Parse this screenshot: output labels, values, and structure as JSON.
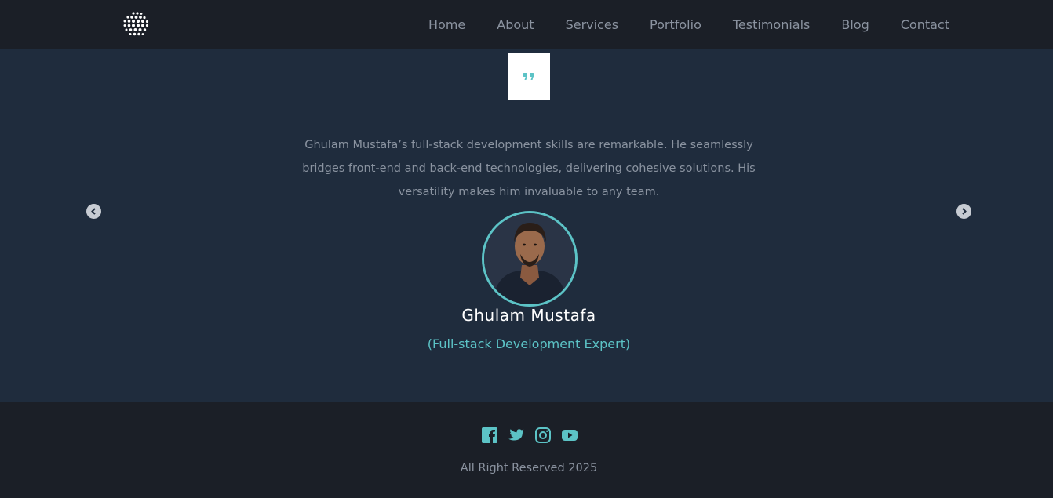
{
  "nav": {
    "logo_icon": "dot-sphere-logo-icon",
    "links": [
      {
        "label": "Home"
      },
      {
        "label": "About"
      },
      {
        "label": "Services"
      },
      {
        "label": "Portfolio"
      },
      {
        "label": "Testimonials"
      },
      {
        "label": "Blog"
      },
      {
        "label": "Contact"
      }
    ]
  },
  "testimonial": {
    "quote_icon": "quote-icon",
    "text": "Ghulam Mustafa’s full-stack development skills are remarkable. He seamlessly bridges front-end and back-end technologies, delivering cohesive solutions. His versatility makes him invaluable to any team.",
    "name": "Ghulam Mustafa",
    "role": "(Full-stack Development Expert)",
    "prev_icon": "chevron-left-icon",
    "next_icon": "chevron-right-icon"
  },
  "footer": {
    "socials": [
      "facebook-icon",
      "twitter-icon",
      "instagram-icon",
      "youtube-icon"
    ],
    "copyright": "All Right Reserved 2025"
  },
  "colors": {
    "accent": "#5cc3c6",
    "nav_bg": "#1b1f27",
    "section_bg": "#1f2c3d",
    "muted_text": "#8b93a0"
  }
}
